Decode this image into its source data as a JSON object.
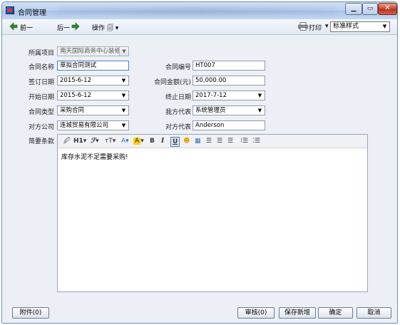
{
  "window": {
    "title": "合同管理"
  },
  "toolbar": {
    "prev_label": "前一",
    "next_label": "后一",
    "actions_label": "操作",
    "print_label": "打印",
    "style_value": "标准样式"
  },
  "form": {
    "project": {
      "label": "所属项目",
      "value": "南天国际商务中心装修"
    },
    "contract_name": {
      "label": "合同名称",
      "value": "草拟合同测试"
    },
    "contract_no": {
      "label": "合同编号",
      "value": "HT007"
    },
    "sign_date": {
      "label": "签订日期",
      "value": "2015-6-12"
    },
    "amount": {
      "label": "合同金额(元)",
      "value": "50,000.00"
    },
    "start_date": {
      "label": "开始日期",
      "value": "2015-6-12"
    },
    "end_date": {
      "label": "终止日期",
      "value": "2017-7-12"
    },
    "contract_type": {
      "label": "合同类型",
      "value": "采购合同"
    },
    "our_rep": {
      "label": "我方代表",
      "value": "系统管理员"
    },
    "counterparty": {
      "label": "对方公司",
      "value": "连城贸易有限公司"
    },
    "their_rep": {
      "label": "对方代表",
      "value": "Anderson"
    },
    "terms": {
      "label": "简要条款",
      "content": "库存水泥不足需要采购!"
    }
  },
  "editor_toolbar": {
    "heading": "H1",
    "font": "𝓕",
    "size": "тT",
    "color": "A",
    "highlight": "A",
    "bold": "B",
    "italic": "I",
    "underline": "U"
  },
  "buttons": {
    "attachments": "附件(0)",
    "review": "审核(0)",
    "save_new": "保存新增",
    "ok": "确定",
    "cancel": "取消"
  }
}
